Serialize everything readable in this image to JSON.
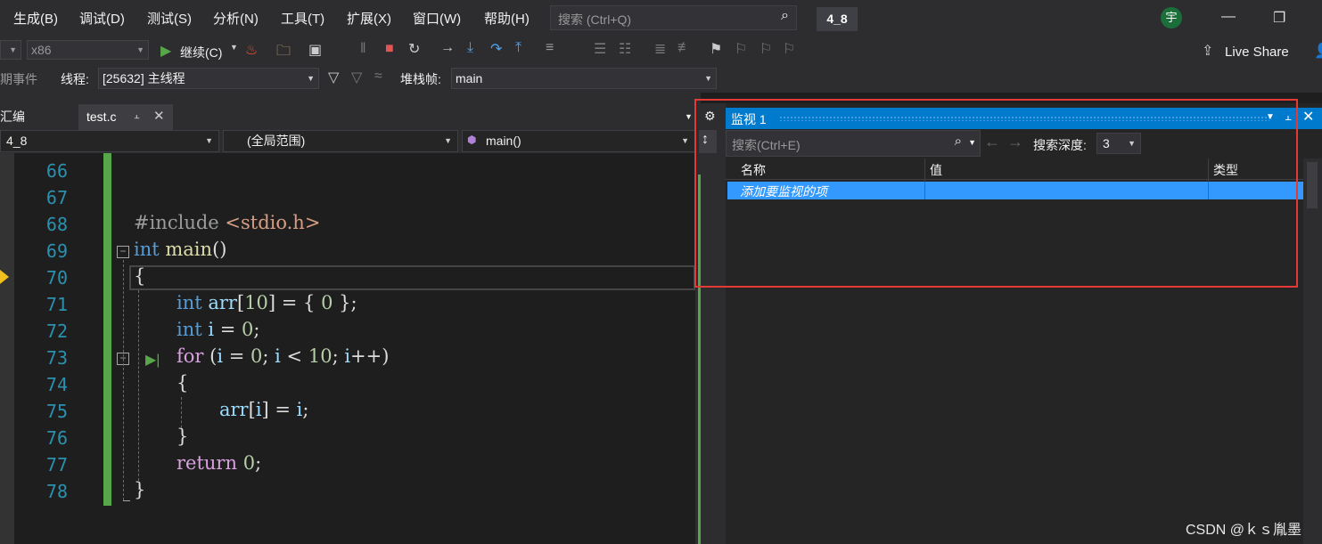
{
  "menu": [
    "生成(B)",
    "调试(D)",
    "测试(S)",
    "分析(N)",
    "工具(T)",
    "扩展(X)",
    "窗口(W)",
    "帮助(H)"
  ],
  "search": {
    "placeholder": "搜索 (Ctrl+Q)"
  },
  "solution_name": "4_8",
  "user_avatar": "宇",
  "live_share": "Live Share",
  "toolbar": {
    "platform": "x86",
    "continue_label": "继续(C)",
    "events_label": "期事件",
    "thread_label": "线程:",
    "thread_value": "[25632] 主线程",
    "stack_label": "堆栈帧:",
    "stack_value": "main"
  },
  "tabs": {
    "left_partial": "汇编",
    "active": "test.c"
  },
  "nav": {
    "project": "4_8",
    "scope": "(全局范围)",
    "function": "main()"
  },
  "code": {
    "line_numbers": [
      "66",
      "67",
      "68",
      "69",
      "70",
      "71",
      "72",
      "73",
      "74",
      "75",
      "76",
      "77",
      "78"
    ],
    "lines": [
      {
        "parts": []
      },
      {
        "parts": []
      },
      {
        "parts": [
          [
            "pp",
            "#include "
          ],
          [
            "str",
            "<stdio.h>"
          ]
        ]
      },
      {
        "parts": [
          [
            "kw",
            "int"
          ],
          [
            "",
            " "
          ],
          [
            "fn",
            "main"
          ],
          [
            "",
            "()"
          ]
        ]
      },
      {
        "parts": [
          [
            "",
            "{"
          ]
        ]
      },
      {
        "parts": [
          [
            "kw",
            "int"
          ],
          [
            "",
            " "
          ],
          [
            "var",
            "arr"
          ],
          [
            "",
            "["
          ],
          [
            "num",
            "10"
          ],
          [
            "",
            "] = { "
          ],
          [
            "num",
            "0"
          ],
          [
            "",
            " };"
          ]
        ]
      },
      {
        "parts": [
          [
            "kw",
            "int"
          ],
          [
            "",
            " "
          ],
          [
            "var",
            "i"
          ],
          [
            "",
            " = "
          ],
          [
            "num",
            "0"
          ],
          [
            "",
            ";"
          ]
        ]
      },
      {
        "parts": [
          [
            "ctl",
            "for"
          ],
          [
            "",
            " ("
          ],
          [
            "var",
            "i"
          ],
          [
            "",
            " = "
          ],
          [
            "num",
            "0"
          ],
          [
            "",
            "; "
          ],
          [
            "var",
            "i"
          ],
          [
            "",
            " < "
          ],
          [
            "num",
            "10"
          ],
          [
            "",
            "; "
          ],
          [
            "var",
            "i"
          ],
          [
            "",
            "++)"
          ]
        ]
      },
      {
        "parts": [
          [
            "",
            "{"
          ]
        ]
      },
      {
        "parts": [
          [
            "var",
            "arr"
          ],
          [
            "",
            "["
          ],
          [
            "var",
            "i"
          ],
          [
            "",
            "] = "
          ],
          [
            "var",
            "i"
          ],
          [
            "",
            ";"
          ]
        ]
      },
      {
        "parts": [
          [
            "",
            "}"
          ]
        ]
      },
      {
        "parts": [
          [
            "ctl",
            "return"
          ],
          [
            "",
            " "
          ],
          [
            "num",
            "0"
          ],
          [
            "",
            ";"
          ]
        ]
      },
      {
        "parts": [
          [
            "",
            "}"
          ]
        ]
      }
    ]
  },
  "watch": {
    "title": "监视 1",
    "search_placeholder": "搜索(Ctrl+E)",
    "depth_label": "搜索深度:",
    "depth_value": "3",
    "columns": [
      "名称",
      "值",
      "类型"
    ],
    "add_item": "添加要监视的项"
  },
  "watermark": "CSDN @ｋｓ胤墨"
}
